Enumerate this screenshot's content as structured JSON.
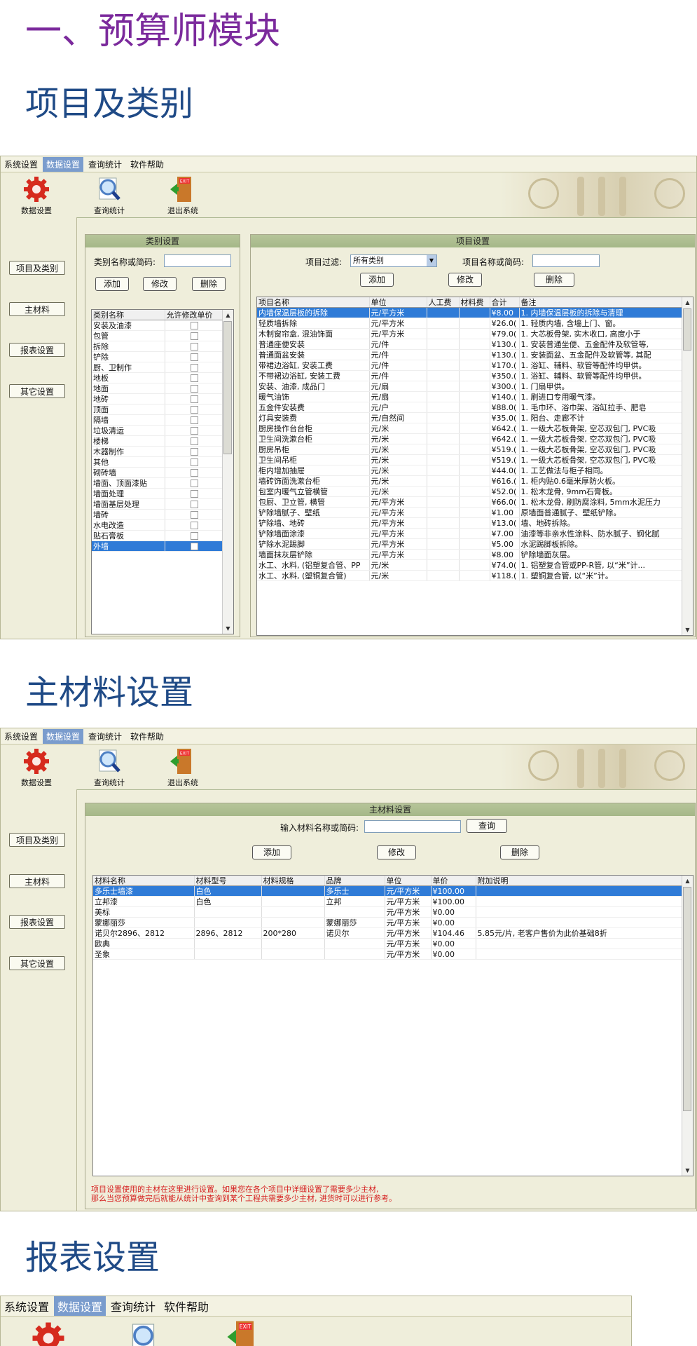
{
  "headings": {
    "h1": "一、预算师模块",
    "h2": "项目及类别",
    "h3": "主材料设置",
    "h4": "报表设置"
  },
  "menu": [
    "系统设置",
    "数据设置",
    "查询统计",
    "软件帮助"
  ],
  "toolbar": [
    "数据设置",
    "查询统计",
    "退出系统"
  ],
  "exit_badge": "EXIT",
  "sidebar": [
    "项目及类别",
    "主材料",
    "报表设置",
    "其它设置"
  ],
  "category": {
    "title": "类别设置",
    "search_label": "类别名称或简码:",
    "search_value": "",
    "buttons": [
      "添加",
      "修改",
      "删除"
    ],
    "columns": [
      "类别名称",
      "允许修改单价"
    ],
    "rows": [
      "安装及油漆",
      "包管",
      "拆除",
      "铲除",
      "厨、卫制作",
      "地板",
      "地面",
      "地砖",
      "顶面",
      "隔墙",
      "垃圾清运",
      "楼梯",
      "木器制作",
      "其他",
      "砌砖墙",
      "墙面、顶面漆贴",
      "墙面处理",
      "墙面基层处理",
      "墙砖",
      "水电改造",
      "贴石膏板",
      "外墙"
    ],
    "selected_index": 21
  },
  "project": {
    "title": "项目设置",
    "filter_label": "项目过滤:",
    "filter_value": "所有类别",
    "search_label": "项目名称或简码:",
    "search_value": "",
    "buttons": [
      "添加",
      "修改",
      "删除"
    ],
    "columns": [
      "项目名称",
      "单位",
      "人工费",
      "材料费",
      "合计",
      "备注"
    ],
    "rows": [
      [
        "内墙保温层板的拆除",
        "元/平方米",
        "",
        "",
        "¥8.00",
        "1. 内墙保温层板的拆除与清理"
      ],
      [
        "轻质墙拆除",
        "元/平方米",
        "",
        "",
        "¥26.0(",
        "1. 轻质内墙, 含墙上门、窗。"
      ],
      [
        "木制窗帘盒, 混油饰面",
        "元/平方米",
        "",
        "",
        "¥79.0(",
        "1. 大芯板骨架, 实木收口, 高度小于"
      ],
      [
        "普通座便安装",
        "元/件",
        "",
        "",
        "¥130.(",
        "1. 安装普通坐便、五金配件及软管等,"
      ],
      [
        "普通面盆安装",
        "元/件",
        "",
        "",
        "¥130.(",
        "1. 安装面盆、五金配件及软管等, 其配"
      ],
      [
        "带裙边浴缸, 安装工费",
        "元/件",
        "",
        "",
        "¥170.(",
        "1. 浴缸、辅料、软管等配件均甲供。"
      ],
      [
        "不带裙边浴缸, 安装工费",
        "元/件",
        "",
        "",
        "¥350.(",
        "1. 浴缸、辅料、软管等配件均甲供。"
      ],
      [
        "安装、油漆, 成品门",
        "元/扇",
        "",
        "",
        "¥300.(",
        "1. 门扇甲供。"
      ],
      [
        "暖气油饰",
        "元/扇",
        "",
        "",
        "¥140.(",
        "1. 刷进口专用暖气漆。"
      ],
      [
        "五金件安装费",
        "元/户",
        "",
        "",
        "¥88.0(",
        "1. 毛巾环、浴巾架、浴缸拉手、肥皂"
      ],
      [
        "灯具安装费",
        "元/自然间",
        "",
        "",
        "¥35.0(",
        "1. 阳台、走廊不计"
      ],
      [
        "厨房操作台台柜",
        "元/米",
        "",
        "",
        "¥642.(",
        "1. 一级大芯板骨架, 空芯双包门, PVC吸"
      ],
      [
        "卫生间洗漱台柜",
        "元/米",
        "",
        "",
        "¥642.(",
        "1. 一级大芯板骨架, 空芯双包门, PVC吸"
      ],
      [
        "厨房吊柜",
        "元/米",
        "",
        "",
        "¥519.(",
        "1. 一级大芯板骨架, 空芯双包门, PVC吸"
      ],
      [
        "卫生间吊柜",
        "元/米",
        "",
        "",
        "¥519.(",
        "1. 一级大芯板骨架, 空芯双包门, PVC吸"
      ],
      [
        "柜内增加抽屉",
        "元/米",
        "",
        "",
        "¥44.0(",
        "1. 工艺做法与柜子相同。"
      ],
      [
        "墙砖饰面洗漱台柜",
        "元/米",
        "",
        "",
        "¥616.(",
        "1. 柜内贴0.6毫米厚防火板。"
      ],
      [
        "包室内暖气立管横管",
        "元/米",
        "",
        "",
        "¥52.0(",
        "1. 松木龙骨, 9mm石膏板。"
      ],
      [
        "包厨、卫立管, 横管",
        "元/平方米",
        "",
        "",
        "¥66.0(",
        "1. 松木龙骨, 刷防腐涂料, 5mm水泥压力"
      ],
      [
        "铲除墙腻子、壁纸",
        "元/平方米",
        "",
        "",
        "¥1.00",
        "原墙面普通腻子、壁纸铲除。"
      ],
      [
        "铲除墙、地砖",
        "元/平方米",
        "",
        "",
        "¥13.0(",
        "墙、地砖拆除。"
      ],
      [
        "铲除墙面涂漆",
        "元/平方米",
        "",
        "",
        "¥7.00",
        "油漆等非亲水性涂料、防水腻子、钢化腻"
      ],
      [
        "铲除水泥踢脚",
        "元/平方米",
        "",
        "",
        "¥5.00",
        "水泥踢脚板拆除。"
      ],
      [
        "墙面抹灰层铲除",
        "元/平方米",
        "",
        "",
        "¥8.00",
        "铲除墙面灰层。"
      ],
      [
        "水工、水料, (铝塑复合管、PP",
        "元/米",
        "",
        "",
        "¥74.0(",
        "1. 铝塑复合管或PP-R管, 以“米”计..."
      ],
      [
        "水工、水料, (塑铜复合管)",
        "元/米",
        "",
        "",
        "¥118.(",
        "1. 塑铜复合管, 以“米”计。"
      ]
    ],
    "selected_index": 0
  },
  "material": {
    "title": "主材料设置",
    "search_label": "输入材料名称或简码:",
    "search_value": "",
    "query_button": "查询",
    "buttons": [
      "添加",
      "修改",
      "删除"
    ],
    "columns": [
      "材料名称",
      "材料型号",
      "材料规格",
      "品牌",
      "单位",
      "单价",
      "附加说明"
    ],
    "rows": [
      [
        "多乐士墙漆",
        "白色",
        "",
        "多乐士",
        "元/平方米",
        "¥100.00",
        ""
      ],
      [
        "立邦漆",
        "白色",
        "",
        "立邦",
        "元/平方米",
        "¥100.00",
        ""
      ],
      [
        "美标",
        "",
        "",
        "",
        "元/平方米",
        "¥0.00",
        ""
      ],
      [
        "蒙娜丽莎",
        "",
        "",
        "蒙娜丽莎",
        "元/平方米",
        "¥0.00",
        ""
      ],
      [
        "诺贝尔2896、2812",
        "2896、2812",
        "200*280",
        "诺贝尔",
        "元/平方米",
        "¥104.46",
        "5.85元/片, 老客户售价为此价基础8折"
      ],
      [
        "欧典",
        "",
        "",
        "",
        "元/平方米",
        "¥0.00",
        ""
      ],
      [
        "圣象",
        "",
        "",
        "",
        "元/平方米",
        "¥0.00",
        ""
      ]
    ],
    "selected_index": 0,
    "note": [
      "项目设置使用的主材在这里进行设置。如果您在各个项目中详细设置了需要多少主材,",
      "那么当您预算做完后就能从统计中查询到某个工程共需要多少主材, 进货时可以进行参考。"
    ]
  },
  "colors": {
    "heading_purple": "#7b2a9c",
    "heading_blue": "#1f4a86",
    "panel_bg": "#efeedb",
    "selection": "#2f7bd7",
    "note_red": "#d62020"
  }
}
